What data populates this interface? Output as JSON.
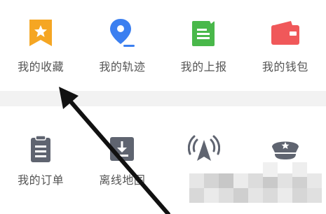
{
  "grid_top": {
    "items": [
      {
        "label": "我的收藏",
        "icon": "bookmark-star-icon",
        "color": "#f5a623"
      },
      {
        "label": "我的轨迹",
        "icon": "location-pin-icon",
        "color": "#3b7ff0"
      },
      {
        "label": "我的上报",
        "icon": "report-edit-icon",
        "color": "#49b84a"
      },
      {
        "label": "我的钱包",
        "icon": "wallet-icon",
        "color": "#f0585a"
      }
    ]
  },
  "grid_bottom": {
    "items": [
      {
        "label": "我的订单",
        "icon": "clipboard-icon",
        "color": "#5f6470"
      },
      {
        "label": "离线地图",
        "icon": "offline-download-icon",
        "color": "#5f6470"
      },
      {
        "label": "",
        "icon": "navigation-signal-icon",
        "color": "#5f6470"
      },
      {
        "label": "",
        "icon": "police-cap-icon",
        "color": "#5f6470"
      }
    ]
  },
  "overlay": {
    "arrow_color": "#111111"
  }
}
